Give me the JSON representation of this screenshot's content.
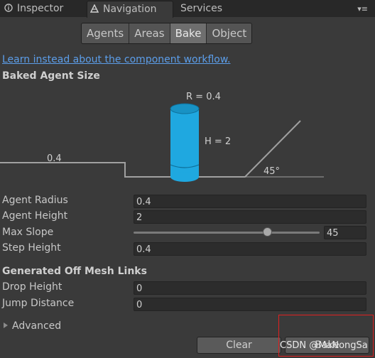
{
  "tabs": [
    {
      "label": "Inspector",
      "icon": "info-icon"
    },
    {
      "label": "Navigation",
      "icon": "navigation-icon"
    },
    {
      "label": "Services"
    }
  ],
  "segments": [
    "Agents",
    "Areas",
    "Bake",
    "Object"
  ],
  "selected_segment": "Bake",
  "link_text": "Learn instead about the component workflow.",
  "baked_section_title": "Baked Agent Size",
  "viz": {
    "radius_label": "R = 0.4",
    "height_label": "H = 2",
    "step_label": "0.4",
    "slope_label": "45°",
    "cylinder_color": "#1fa8e0"
  },
  "fields": {
    "agent_radius": {
      "label": "Agent Radius",
      "value": "0.4"
    },
    "agent_height": {
      "label": "Agent Height",
      "value": "2"
    },
    "max_slope": {
      "label": "Max Slope",
      "value": "45",
      "level_fraction": 0.72
    },
    "step_height": {
      "label": "Step Height",
      "value": "0.4"
    }
  },
  "offmesh_section_title": "Generated Off Mesh Links",
  "offmesh": {
    "drop_height": {
      "label": "Drop Height",
      "value": "0"
    },
    "jump_distance": {
      "label": "Jump Distance",
      "value": "0"
    }
  },
  "advanced_label": "Advanced",
  "buttons": {
    "clear": "Clear",
    "bake": "Bake"
  },
  "watermark": "CSDN @MaNongSa"
}
